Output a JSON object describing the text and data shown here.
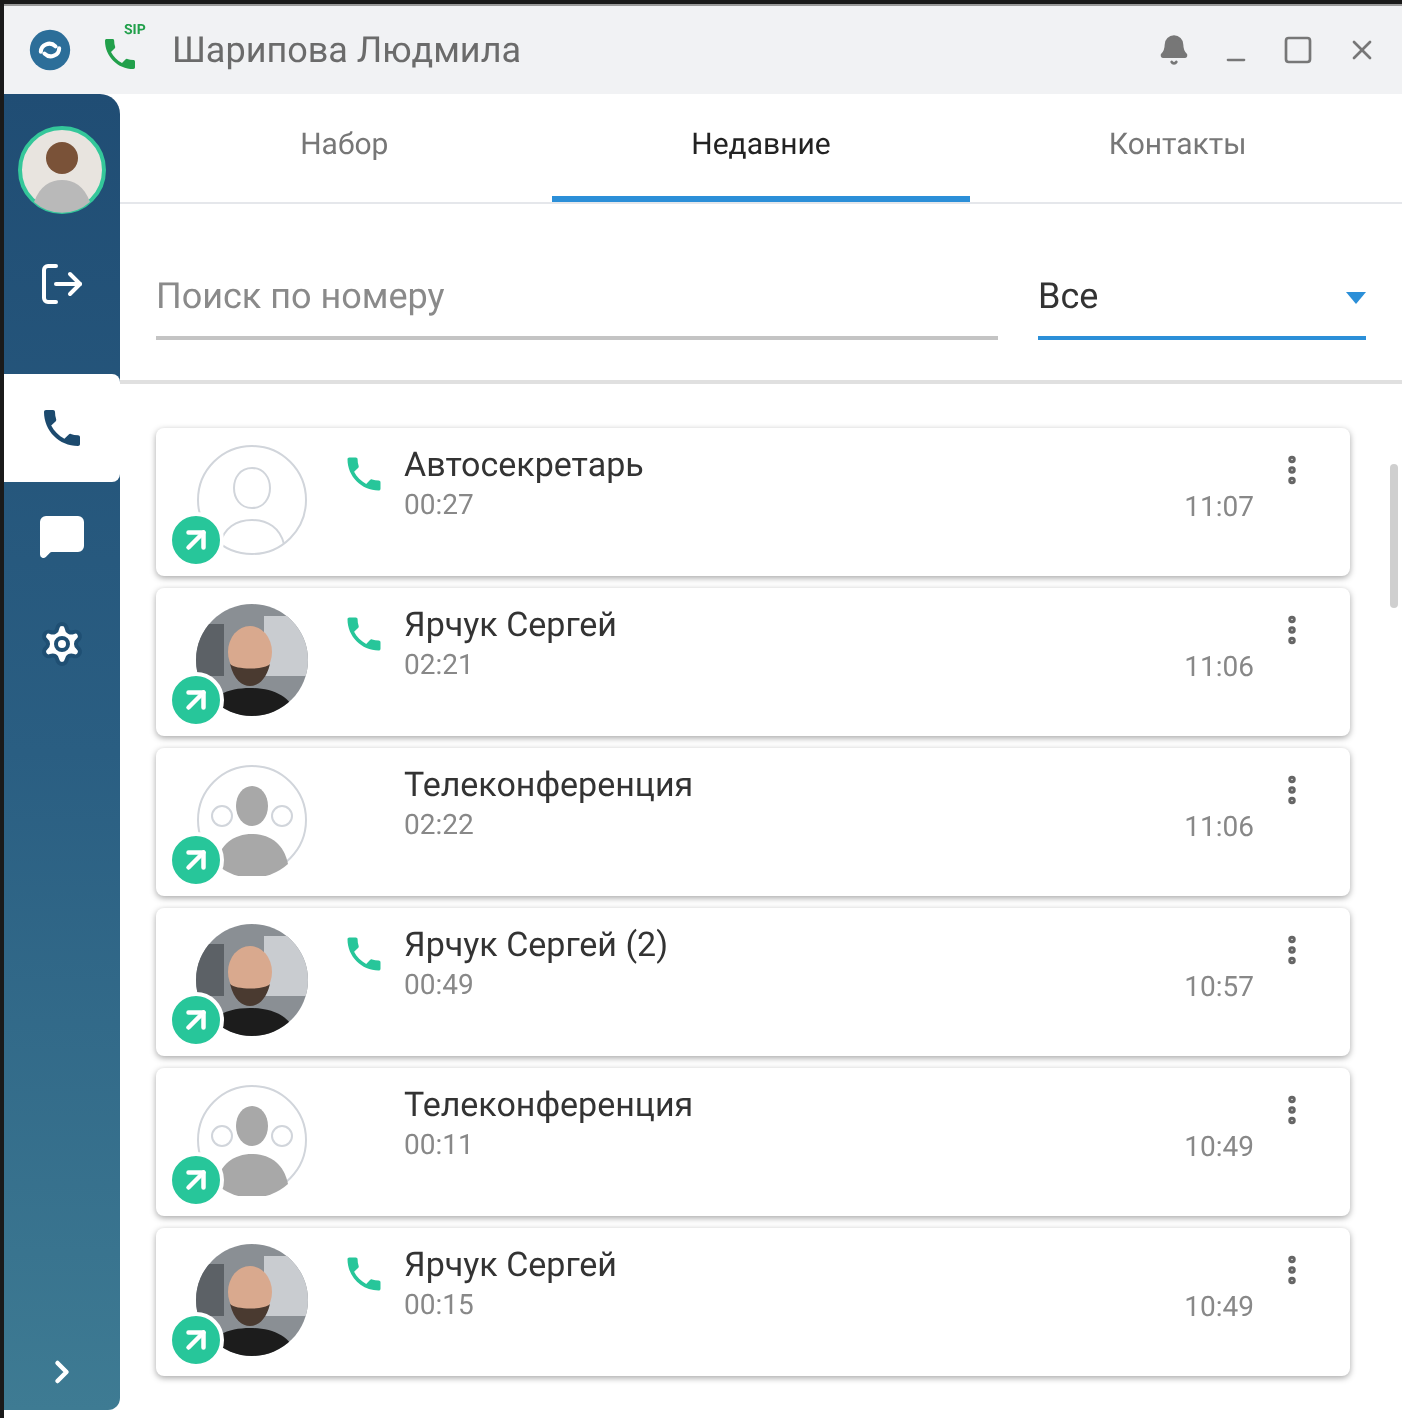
{
  "window": {
    "title": "Шарипова Людмила",
    "sip_status": "SIP"
  },
  "sidebar": {
    "items": [
      {
        "kind": "logout",
        "selected": false
      },
      {
        "kind": "calls",
        "selected": true
      },
      {
        "kind": "chat",
        "selected": false
      },
      {
        "kind": "settings",
        "selected": false
      }
    ]
  },
  "tabs": [
    {
      "label": "Набор",
      "selected": false
    },
    {
      "label": "Недавние",
      "selected": true
    },
    {
      "label": "Контакты",
      "selected": false
    }
  ],
  "search": {
    "placeholder": "Поиск по номеру"
  },
  "filter": {
    "value": "Все"
  },
  "calls": [
    {
      "name": "Автосекретарь",
      "duration": "00:27",
      "time": "11:07",
      "avatar": {
        "kind": "blank"
      },
      "phone_icon": true
    },
    {
      "name": "Ярчук Сергей",
      "duration": "02:21",
      "time": "11:06",
      "phone_icon": true
    },
    {
      "name": "Телеконференция",
      "duration": "02:22",
      "time": "11:06",
      "avatar": {
        "kind": "group"
      },
      "phone_icon": false
    },
    {
      "name": "Ярчук Сергей (2)",
      "duration": "00:49",
      "time": "10:57",
      "phone_icon": true
    },
    {
      "name": "Телеконференция",
      "duration": "00:11",
      "time": "10:49",
      "avatar": {
        "kind": "group"
      },
      "phone_icon": false
    },
    {
      "name": "Ярчук Сергей",
      "duration": "00:15",
      "time": "10:49",
      "phone_icon": true
    }
  ]
}
